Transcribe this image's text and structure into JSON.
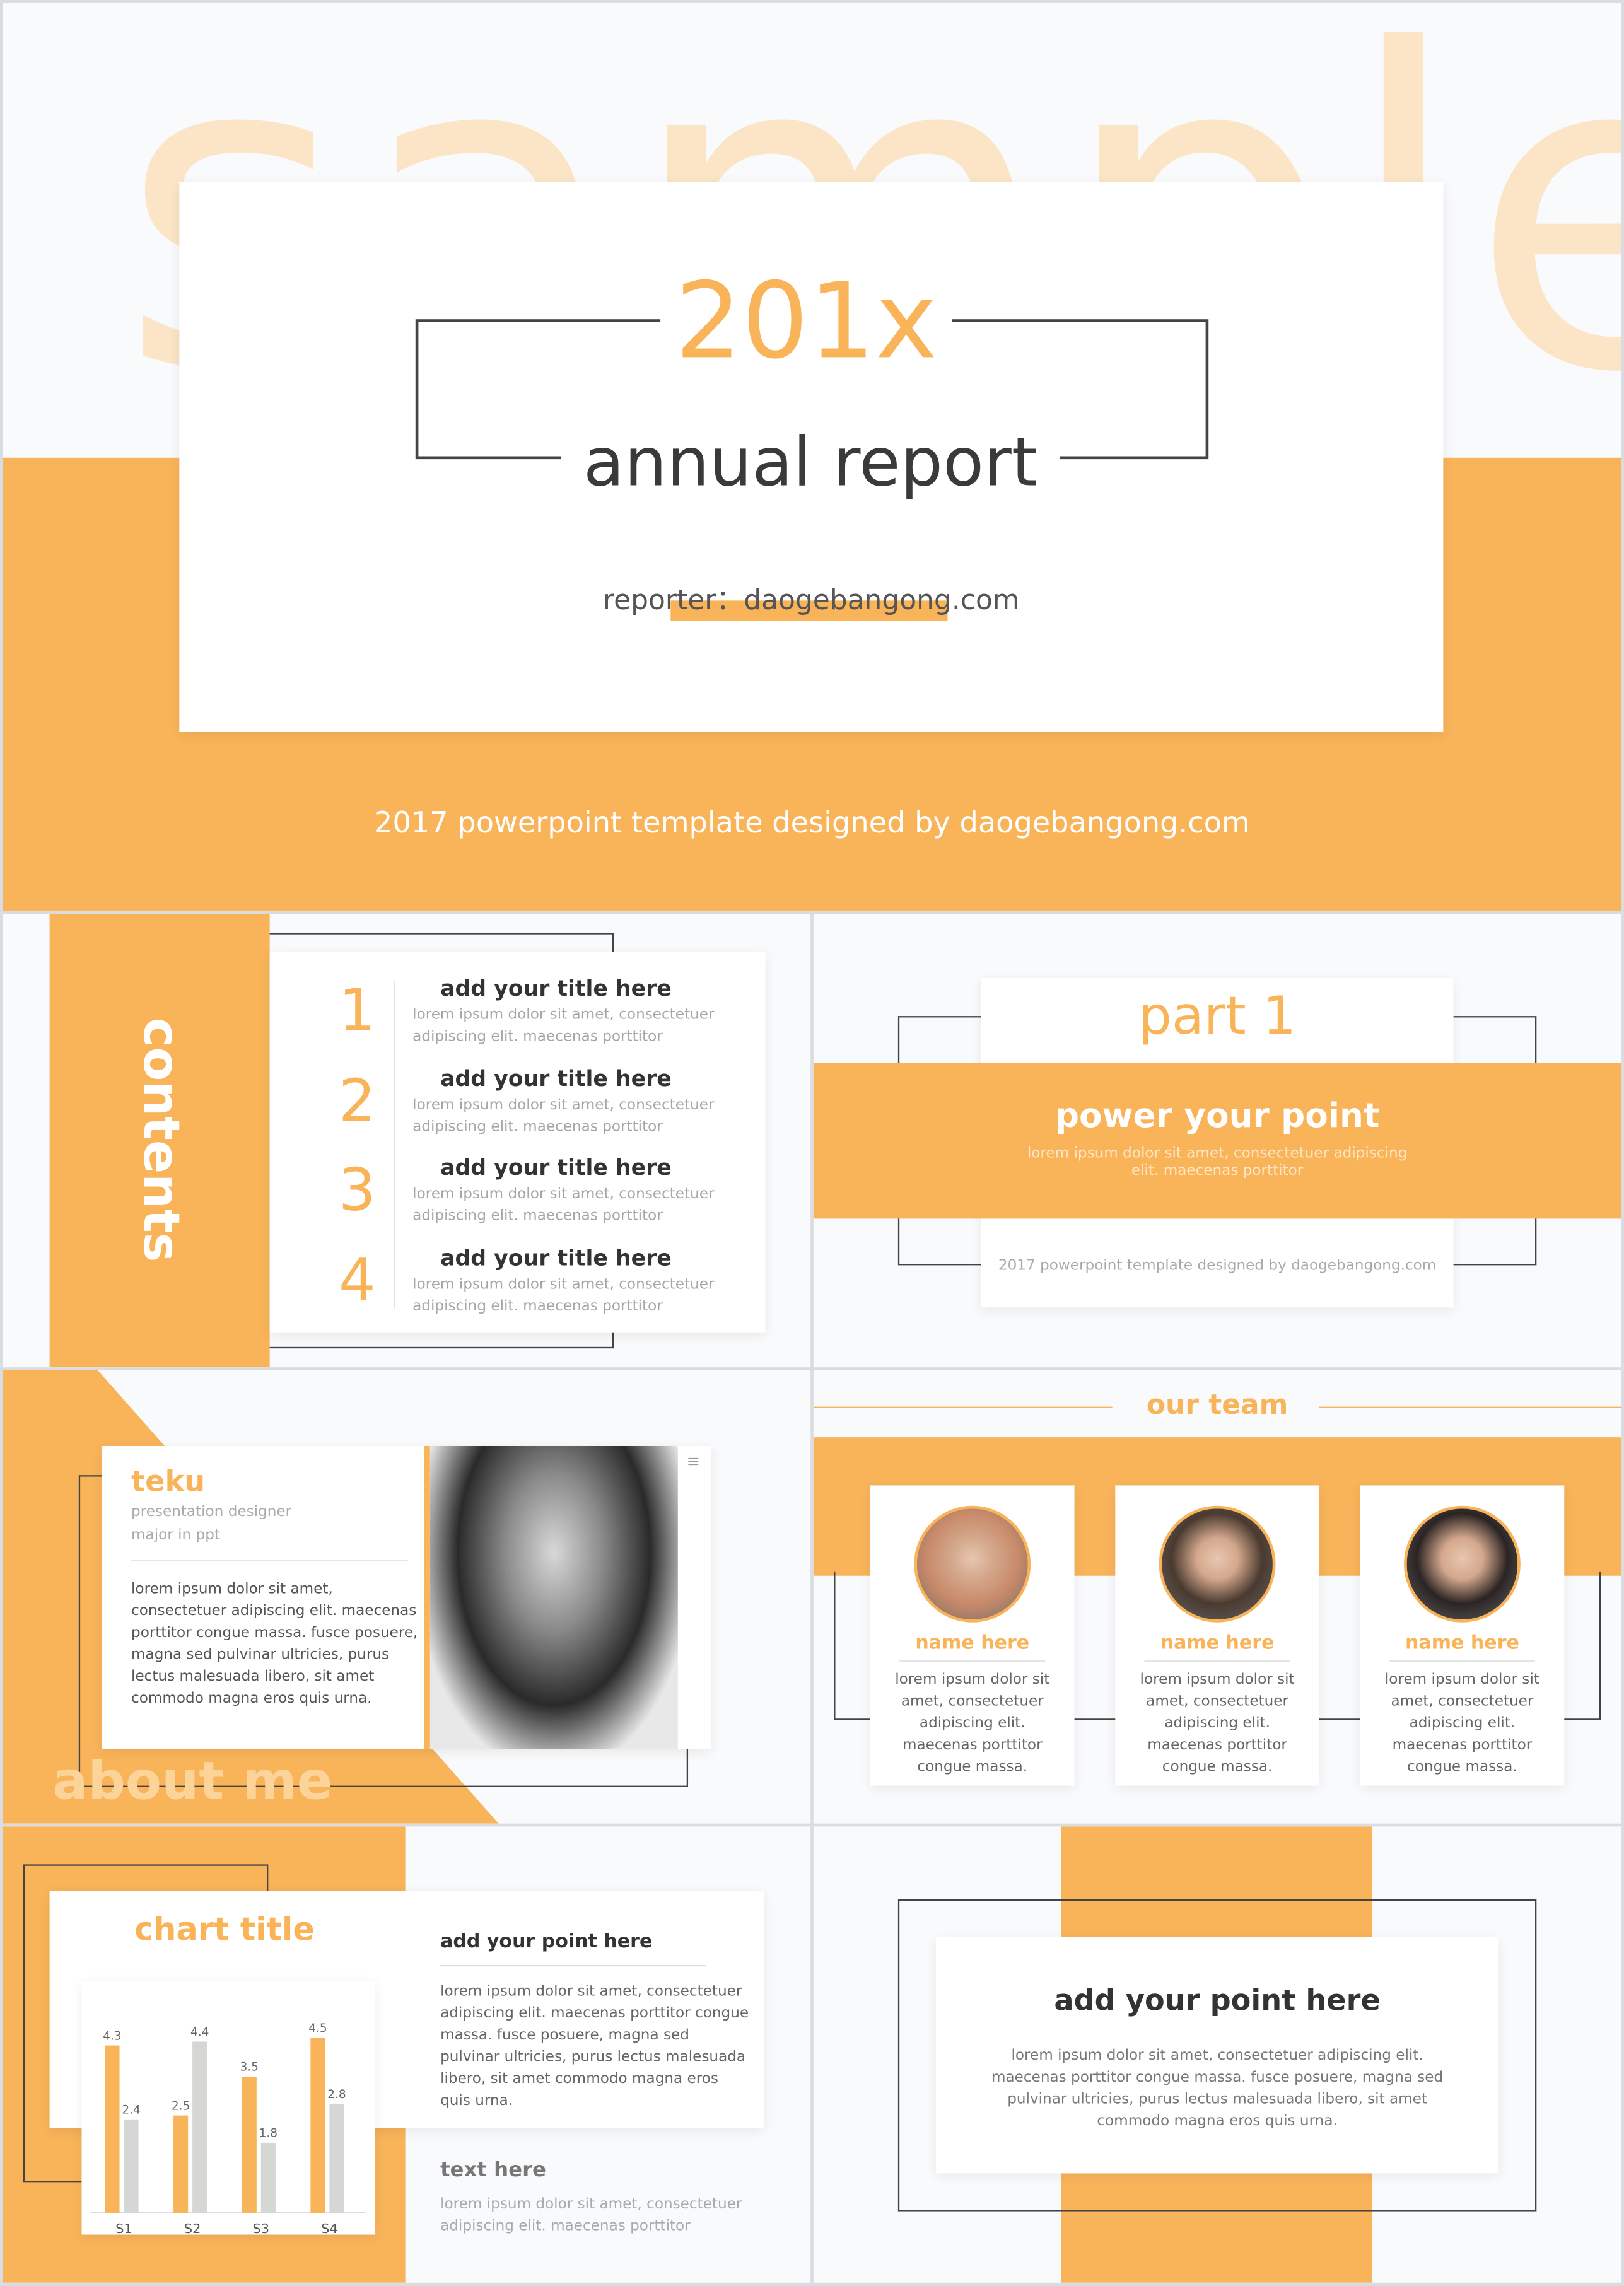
{
  "accent": "#f9b45a",
  "cover": {
    "watermark": "sample",
    "year": "201x",
    "title": "annual report",
    "reporter": "reporter：daogebangong.com",
    "footer": "2017 powerpoint template designed by daogebangong.com"
  },
  "contents": {
    "heading": "contents",
    "items": [
      {
        "num": "1",
        "title": "add your title here",
        "desc": "lorem ipsum dolor sit amet, consectetuer adipiscing elit. maecenas porttitor"
      },
      {
        "num": "2",
        "title": "add your title here",
        "desc": "lorem ipsum dolor sit amet, consectetuer adipiscing elit. maecenas porttitor"
      },
      {
        "num": "3",
        "title": "add your title here",
        "desc": "lorem ipsum dolor sit amet, consectetuer adipiscing elit. maecenas porttitor"
      },
      {
        "num": "4",
        "title": "add your title here",
        "desc": "lorem ipsum dolor sit amet, consectetuer adipiscing elit. maecenas porttitor"
      }
    ]
  },
  "part": {
    "label": "part 1",
    "title": "power your point",
    "desc": "lorem ipsum dolor sit amet, consectetuer adipiscing elit. maecenas porttitor",
    "footer": "2017 powerpoint template designed by daogebangong.com"
  },
  "about": {
    "name": "teku",
    "role": "presentation designer",
    "major": "major in ppt",
    "bio": "lorem ipsum dolor sit amet, consectetuer adipiscing elit. maecenas porttitor congue massa. fusce posuere, magna sed pulvinar ultricies, purus lectus malesuada libero, sit amet commodo magna eros quis urna.",
    "watermark": "about me",
    "menu_icon": "menu-icon"
  },
  "team": {
    "heading": "our team",
    "members": [
      {
        "name": "name here",
        "desc": "lorem ipsum dolor sit amet, consectetuer adipiscing elit. maecenas porttitor congue massa."
      },
      {
        "name": "name here",
        "desc": "lorem ipsum dolor sit amet, consectetuer adipiscing elit. maecenas porttitor congue massa."
      },
      {
        "name": "name here",
        "desc": "lorem ipsum dolor sit amet, consectetuer adipiscing elit. maecenas porttitor congue massa."
      }
    ]
  },
  "chartslide": {
    "point_title": "add your point here",
    "point_desc": "lorem ipsum dolor sit amet, consectetuer adipiscing elit. maecenas porttitor congue massa. fusce posuere, magna sed pulvinar ultricies, purus lectus malesuada libero, sit amet commodo magna eros quis urna.",
    "text_title": "text here",
    "text_desc": "lorem ipsum dolor sit amet, consectetuer adipiscing elit. maecenas porttitor"
  },
  "chart_data": {
    "type": "bar",
    "title": "chart title",
    "categories": [
      "S1",
      "S2",
      "S3",
      "S4"
    ],
    "series": [
      {
        "values": [
          4.3,
          2.5,
          3.5,
          4.5
        ],
        "color": "#f9b45a"
      },
      {
        "values": [
          2.4,
          4.4,
          1.8,
          2.8
        ],
        "color": "#d6d6d4"
      }
    ],
    "ylim": [
      0,
      5
    ],
    "grid": false
  },
  "last": {
    "title": "add your point here",
    "desc": "lorem ipsum dolor sit amet, consectetuer adipiscing elit. maecenas porttitor congue massa. fusce posuere, magna sed pulvinar ultricies, purus lectus malesuada libero, sit amet commodo magna eros quis urna."
  }
}
